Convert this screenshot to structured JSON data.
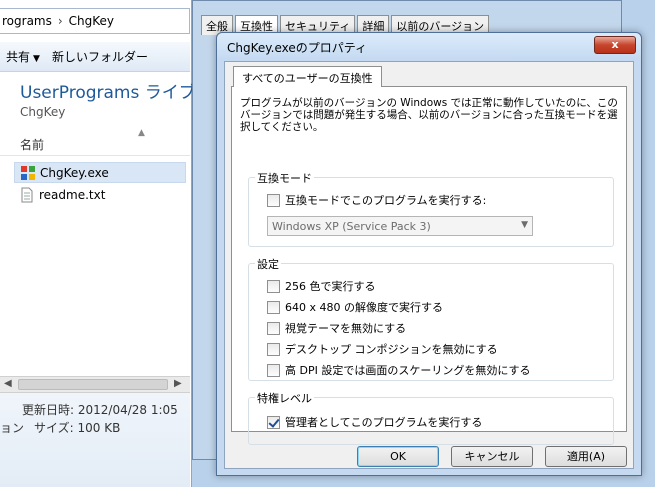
{
  "explorer": {
    "breadcrumb": [
      "rograms",
      "ChgKey"
    ],
    "breadcrumb_sep": "›",
    "toolbar": {
      "share_label": "共有",
      "new_folder_label": "新しいフォルダー"
    },
    "library_title": "UserPrograms ライブ",
    "library_subtitle": "ChgKey",
    "column_name": "名前",
    "files": [
      {
        "name": "ChgKey.exe",
        "icon": "application-icon"
      },
      {
        "name": "readme.txt",
        "icon": "text-file-icon"
      }
    ],
    "details": {
      "modified": "更新日時: 2012/04/28 1:05",
      "size_prefix": "ョン",
      "size": "サイズ: 100 KB"
    }
  },
  "back_dialog": {
    "tabs": [
      "全般",
      "互換性",
      "セキュリティ",
      "詳細",
      "以前のバージョン"
    ]
  },
  "dialog": {
    "title": "ChgKey.exeのプロパティ",
    "close_label": "x",
    "tab_label": "すべてのユーザーの互換性",
    "intro": "プログラムが以前のバージョンの Windows では正常に動作していたのに、このバージョンでは問題が発生する場合、以前のバージョンに合った互換モードを選択してください。",
    "compat_group": {
      "label": "互換モード",
      "checkbox_label": "互換モードでこのプログラムを実行する:",
      "checked": false,
      "os_value": "Windows XP (Service Pack 3)"
    },
    "settings_group": {
      "label": "設定",
      "items": [
        {
          "label": "256 色で実行する",
          "checked": false
        },
        {
          "label": "640 x 480 の解像度で実行する",
          "checked": false
        },
        {
          "label": "視覚テーマを無効にする",
          "checked": false
        },
        {
          "label": "デスクトップ コンポジションを無効にする",
          "checked": false
        },
        {
          "label": "高 DPI 設定では画面のスケーリングを無効にする",
          "checked": false
        }
      ]
    },
    "privilege_group": {
      "label": "特権レベル",
      "checkbox_label": "管理者としてこのプログラムを実行する",
      "checked": true
    },
    "buttons": {
      "ok": "OK",
      "cancel": "キャンセル",
      "apply": "適用(A)"
    }
  }
}
